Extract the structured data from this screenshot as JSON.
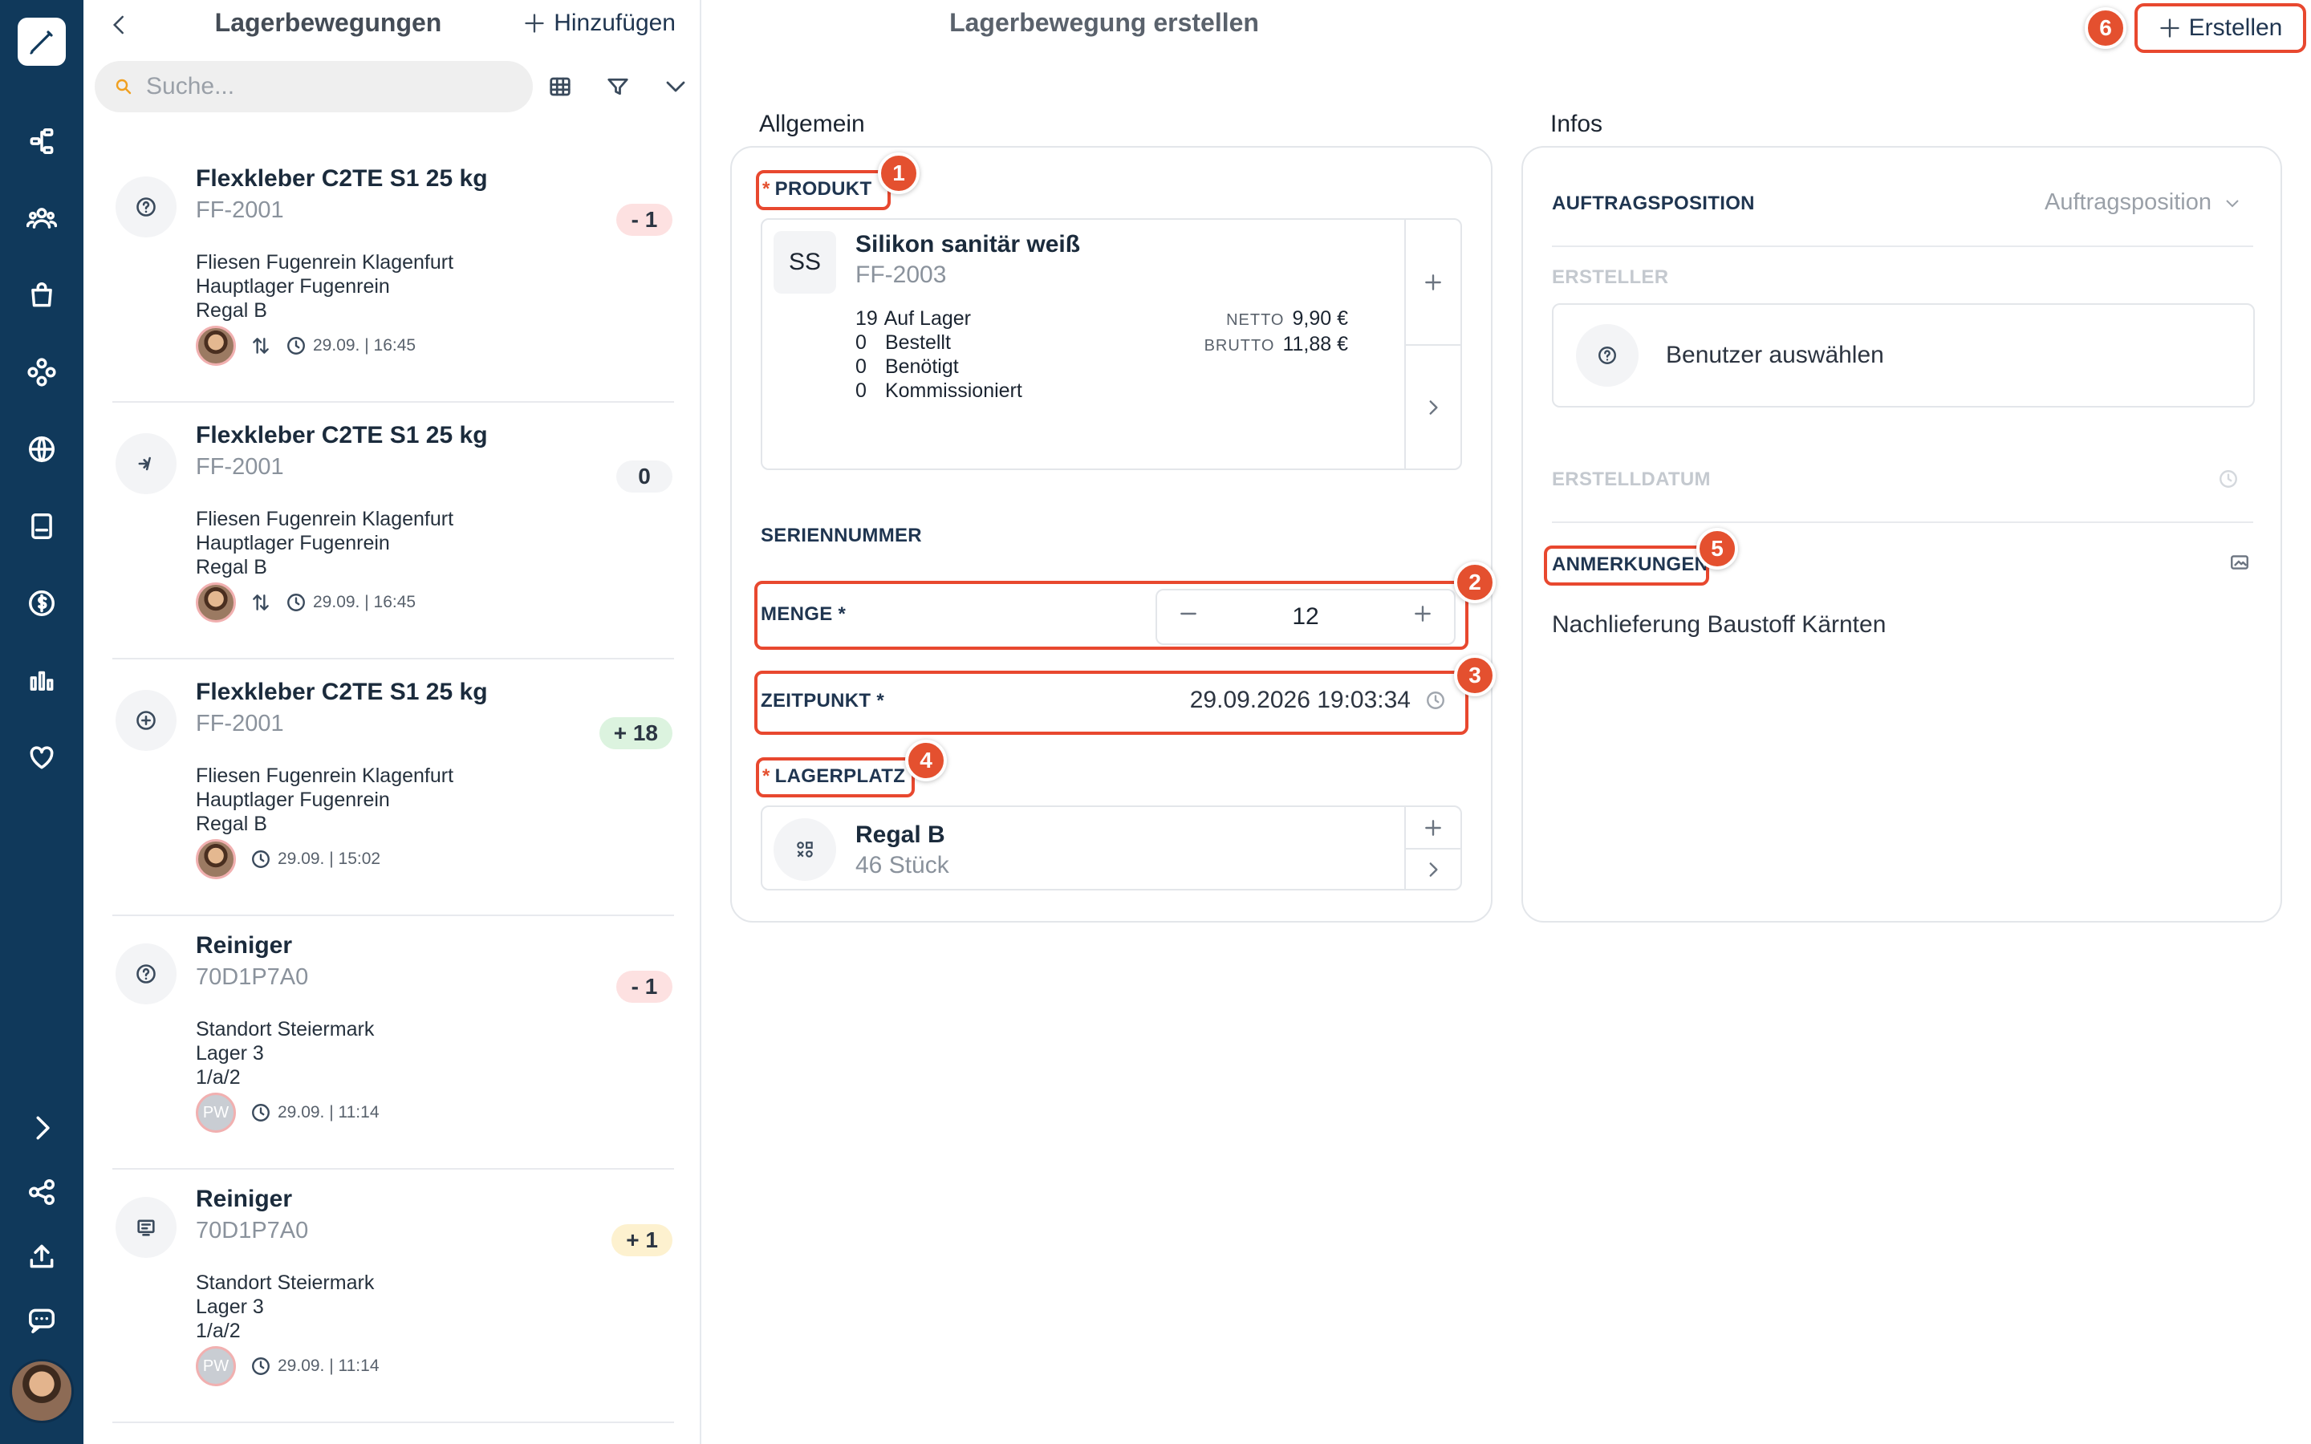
{
  "rail": {
    "icons": [
      "pen-logo-icon",
      "workflow-icon",
      "users-icon",
      "bag-icon",
      "modules-icon",
      "globe-icon",
      "book-icon",
      "dollar-icon",
      "chart-icon",
      "heart-icon",
      "chevron-right-icon",
      "share-icon",
      "upload-icon",
      "chat-icon"
    ]
  },
  "list": {
    "title": "Lagerbewegungen",
    "add_label": "Hinzufügen",
    "search_placeholder": "Suche...",
    "items": [
      {
        "title": "Flexkleber C2TE S1 25 kg",
        "sku": "FF-2001",
        "badge": "- 1",
        "badge_kind": "negative",
        "icon": "question-icon",
        "loc1": "Fliesen Fugenrein Klagenfurt",
        "loc2": "Hauptlager Fugenrein",
        "loc3": "Regal B",
        "user": "avatar",
        "transfer": true,
        "time": "29.09. | 16:45"
      },
      {
        "title": "Flexkleber C2TE S1 25 kg",
        "sku": "FF-2001",
        "badge": "0",
        "badge_kind": "zero",
        "icon": "correction-icon",
        "loc1": "Fliesen Fugenrein Klagenfurt",
        "loc2": "Hauptlager Fugenrein",
        "loc3": "Regal B",
        "user": "avatar",
        "transfer": true,
        "time": "29.09. | 16:45"
      },
      {
        "title": "Flexkleber C2TE S1 25 kg",
        "sku": "FF-2001",
        "badge": "+ 18",
        "badge_kind": "positive",
        "icon": "plus-circle-icon",
        "loc1": "Fliesen Fugenrein Klagenfurt",
        "loc2": "Hauptlager Fugenrein",
        "loc3": "Regal B",
        "user": "avatar",
        "transfer": false,
        "time": "29.09. | 15:02"
      },
      {
        "title": "Reiniger",
        "sku": "70D1P7A0",
        "badge": "- 1",
        "badge_kind": "negative",
        "icon": "question-icon",
        "loc1": "Standort Steiermark",
        "loc2": "Lager 3",
        "loc3": "1/a/2",
        "user": "PW",
        "transfer": false,
        "time": "29.09. | 11:14"
      },
      {
        "title": "Reiniger",
        "sku": "70D1P7A0",
        "badge": "+ 1",
        "badge_kind": "yellow",
        "icon": "receipt-icon",
        "loc1": "Standort Steiermark",
        "loc2": "Lager 3",
        "loc3": "1/a/2",
        "user": "PW",
        "transfer": false,
        "time": "29.09. | 11:14"
      }
    ]
  },
  "main": {
    "title": "Lagerbewegung erstellen",
    "create_label": "Erstellen",
    "sections": {
      "general": "Allgemein",
      "infos": "Infos"
    },
    "product": {
      "label": "PRODUKT",
      "initials": "SS",
      "name": "Silikon sanitär weiß",
      "sku": "FF-2003",
      "stock": [
        {
          "n": "19",
          "label": "Auf Lager"
        },
        {
          "n": "0",
          "label": "Bestellt"
        },
        {
          "n": "0",
          "label": "Benötigt"
        },
        {
          "n": "0",
          "label": "Kommissioniert"
        }
      ],
      "netto_label": "NETTO",
      "netto": "9,90 €",
      "brutto_label": "BRUTTO",
      "brutto": "11,88 €"
    },
    "serial_label": "SERIENNUMMER",
    "quantity": {
      "label": "MENGE *",
      "value": "12"
    },
    "timestamp": {
      "label": "ZEITPUNKT *",
      "value": "29.09.2026 19:03:34"
    },
    "storage": {
      "label": "LAGERPLATZ",
      "name": "Regal B",
      "sub": "46 Stück"
    },
    "infos": {
      "order_position_label": "AUFTRAGSPOSITION",
      "order_position_placeholder": "Auftragsposition",
      "creator_label": "ERSTELLER",
      "creator_placeholder": "Benutzer auswählen",
      "created_date_label": "ERSTELLDATUM",
      "notes_label": "ANMERKUNGEN",
      "notes_value": "Nachlieferung Baustoff Kärnten"
    },
    "markers": [
      "1",
      "2",
      "3",
      "4",
      "5",
      "6"
    ]
  },
  "colors": {
    "rail": "#10395b",
    "accent": "#e8482f",
    "marker": "#e4502f"
  }
}
